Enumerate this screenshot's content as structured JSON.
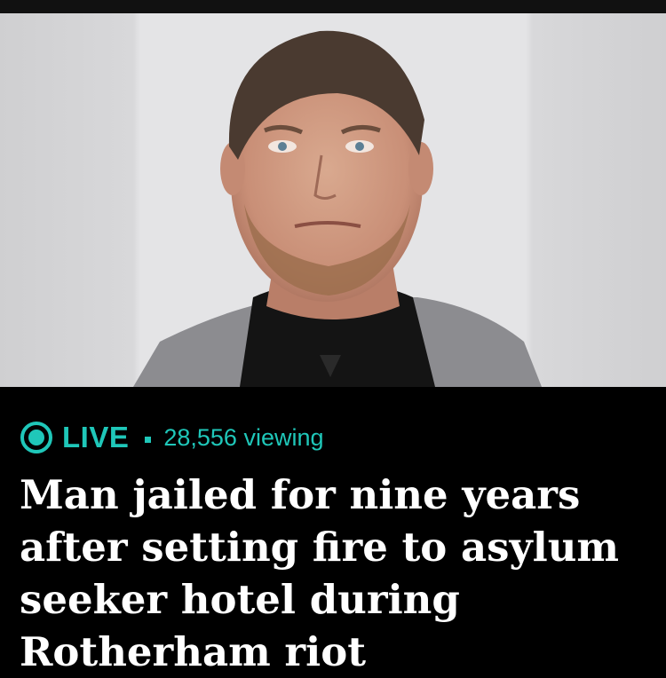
{
  "live": {
    "label": "LIVE",
    "viewers": "28,556 viewing",
    "accent_color": "#1fc7b9",
    "icon": "live-broadcast-icon"
  },
  "headline": "Man jailed for nine years after setting fire to asylum seeker hotel during Rotherham riot",
  "photo": {
    "icon": "mugshot-photo"
  }
}
